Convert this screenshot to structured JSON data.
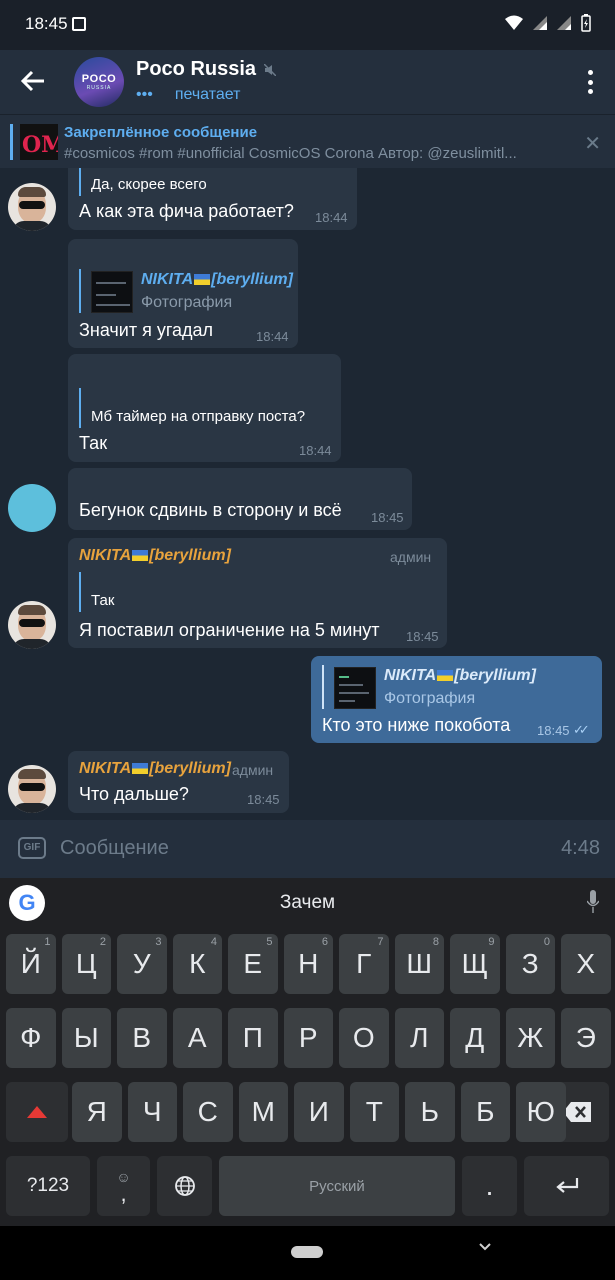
{
  "status_bar": {
    "time": "18:45"
  },
  "header": {
    "avatar_text": "POCO",
    "avatar_sub": "RUSSIA",
    "title": "Poco Russia",
    "typing_dots": "•••",
    "typing_text": "печатает"
  },
  "pinned": {
    "title": "Закреплённое сообщение",
    "text": "#cosmicos #rom #unofficial CosmicOS Corona Автор: @zeuslimitl...",
    "thumb_text": "OM"
  },
  "messages": [
    {
      "reply_text": "Да, скорее всего",
      "text": "А как эта фича работает?",
      "time": "18:44"
    },
    {
      "reply_name": "NIKITA",
      "reply_name_suffix": "[beryllium]",
      "reply_text": "Фотография",
      "text": "Значит я угадал",
      "time": "18:44"
    },
    {
      "reply_text": "Мб таймер на отправку поста?",
      "text": "Так",
      "time": "18:44"
    },
    {
      "text": "Бегунок сдвинь в сторону и всё",
      "time": "18:45"
    },
    {
      "sender": "NIKITA",
      "sender_suffix": "[beryllium]",
      "badge": "админ",
      "reply_text": "Так",
      "text": "Я поставил ограничение на 5 минут",
      "time": "18:45"
    },
    {
      "reply_name": "NIKITA",
      "reply_name_suffix": "[beryllium]",
      "reply_text": "Фотография",
      "text": "Кто это ниже покобота",
      "time": "18:45",
      "outgoing": true
    },
    {
      "sender": "NIKITA",
      "sender_suffix": "[beryllium]",
      "badge": "админ",
      "text": "Что дальше?",
      "time": "18:45"
    }
  ],
  "input": {
    "placeholder": "Сообщение",
    "gif_label": "GIF",
    "timer": "4:48"
  },
  "keyboard": {
    "suggestion": "Зачем",
    "row1": [
      "Й",
      "Ц",
      "У",
      "К",
      "Е",
      "Н",
      "Г",
      "Ш",
      "Щ",
      "З",
      "Х"
    ],
    "row1_hints": [
      "1",
      "2",
      "3",
      "4",
      "5",
      "6",
      "7",
      "8",
      "9",
      "0",
      ""
    ],
    "row2": [
      "Ф",
      "Ы",
      "В",
      "А",
      "П",
      "Р",
      "О",
      "Л",
      "Д",
      "Ж",
      "Э"
    ],
    "row3": [
      "Я",
      "Ч",
      "С",
      "М",
      "И",
      "Т",
      "Ь",
      "Б",
      "Ю"
    ],
    "symbols": "?123",
    "emoji_comma": ",",
    "space": "Русский",
    "period": "."
  },
  "colors": {
    "accent": "#5eaef0",
    "admin_name": "#e8a33d",
    "outgoing_bubble": "#3e6a99",
    "incoming_bubble": "#2a3644"
  }
}
